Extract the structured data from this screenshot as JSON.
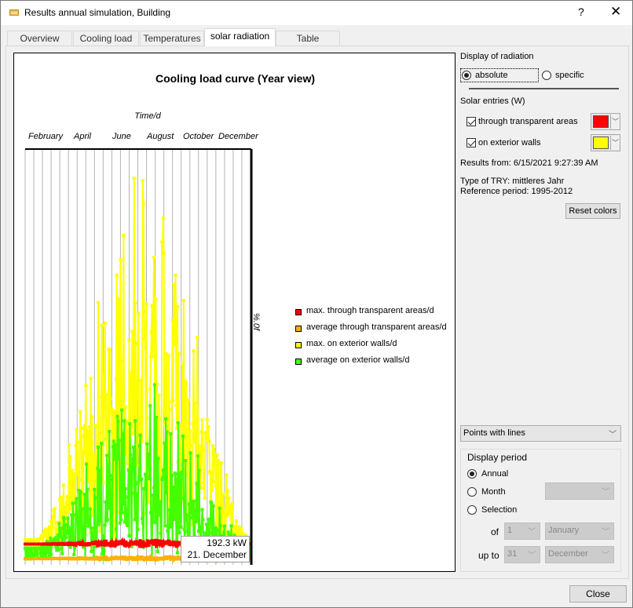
{
  "window": {
    "title": "Results annual simulation, Building",
    "help_label": "?",
    "close_glyph": "✕",
    "icon": "table-icon"
  },
  "tabs": [
    {
      "label": "Overview",
      "active": false
    },
    {
      "label": "Cooling load",
      "active": false
    },
    {
      "label": "Temperatures",
      "active": false
    },
    {
      "label": "solar radiation",
      "active": true
    },
    {
      "label": "Table",
      "active": false
    }
  ],
  "right_panel": {
    "display_heading": "Display of radiation",
    "radio_absolute": "absolute",
    "radio_specific": "specific",
    "selected_display": "absolute",
    "solar_heading": "Solar entries (W)",
    "check_transparent": "through transparent areas",
    "check_walls": "on exterior walls",
    "transparent_checked": true,
    "walls_checked": true,
    "transparent_color": "#ff0000",
    "walls_color": "#ffff00",
    "results_from": "Results from: 6/15/2021 9:27:39 AM",
    "try_type": "Type of TRY: mittleres Jahr",
    "reference_period": "Reference period: 1995-2012",
    "reset_colors": "Reset colors",
    "chart_style": "Points with lines",
    "period_heading": "Display period",
    "period_annual": "Annual",
    "period_month": "Month",
    "period_selection": "Selection",
    "selected_period": "Annual",
    "month_value": "",
    "of_label": "of",
    "upto_label": "up to",
    "from_day": "1",
    "from_month": "January",
    "to_day": "31",
    "to_month": "December"
  },
  "footer": {
    "close_label": "Close"
  },
  "tooltip": {
    "value": "192.3 kW",
    "date": "21. December"
  },
  "chart_data": {
    "type": "line",
    "title": "Cooling load curve (Year view)",
    "xlabel": "Time/d",
    "ylabel": "%.0f",
    "x_tick_labels": [
      "February",
      "April",
      "June",
      "August",
      "October",
      "December"
    ],
    "x_range_days": [
      1,
      365
    ],
    "grid": "vertical",
    "legend_position": "right",
    "y_relative_range": [
      0,
      1
    ],
    "series": [
      {
        "name": "max. through transparent areas/d",
        "color": "#ff0000",
        "base": 0.05,
        "amplitude": 0.01,
        "noise": 0.012
      },
      {
        "name": "average through transparent areas/d",
        "color": "#ffb000",
        "base": 0.015,
        "amplitude": 0.005,
        "noise": 0.006
      },
      {
        "name": "max. on exterior walls/d",
        "color": "#ffff00",
        "base": 0.06,
        "amplitude": 0.92,
        "noise": 0.45
      },
      {
        "name": "average on exterior walls/d",
        "color": "#44ff00",
        "base": 0.04,
        "amplitude": 0.42,
        "noise": 0.3
      }
    ]
  }
}
